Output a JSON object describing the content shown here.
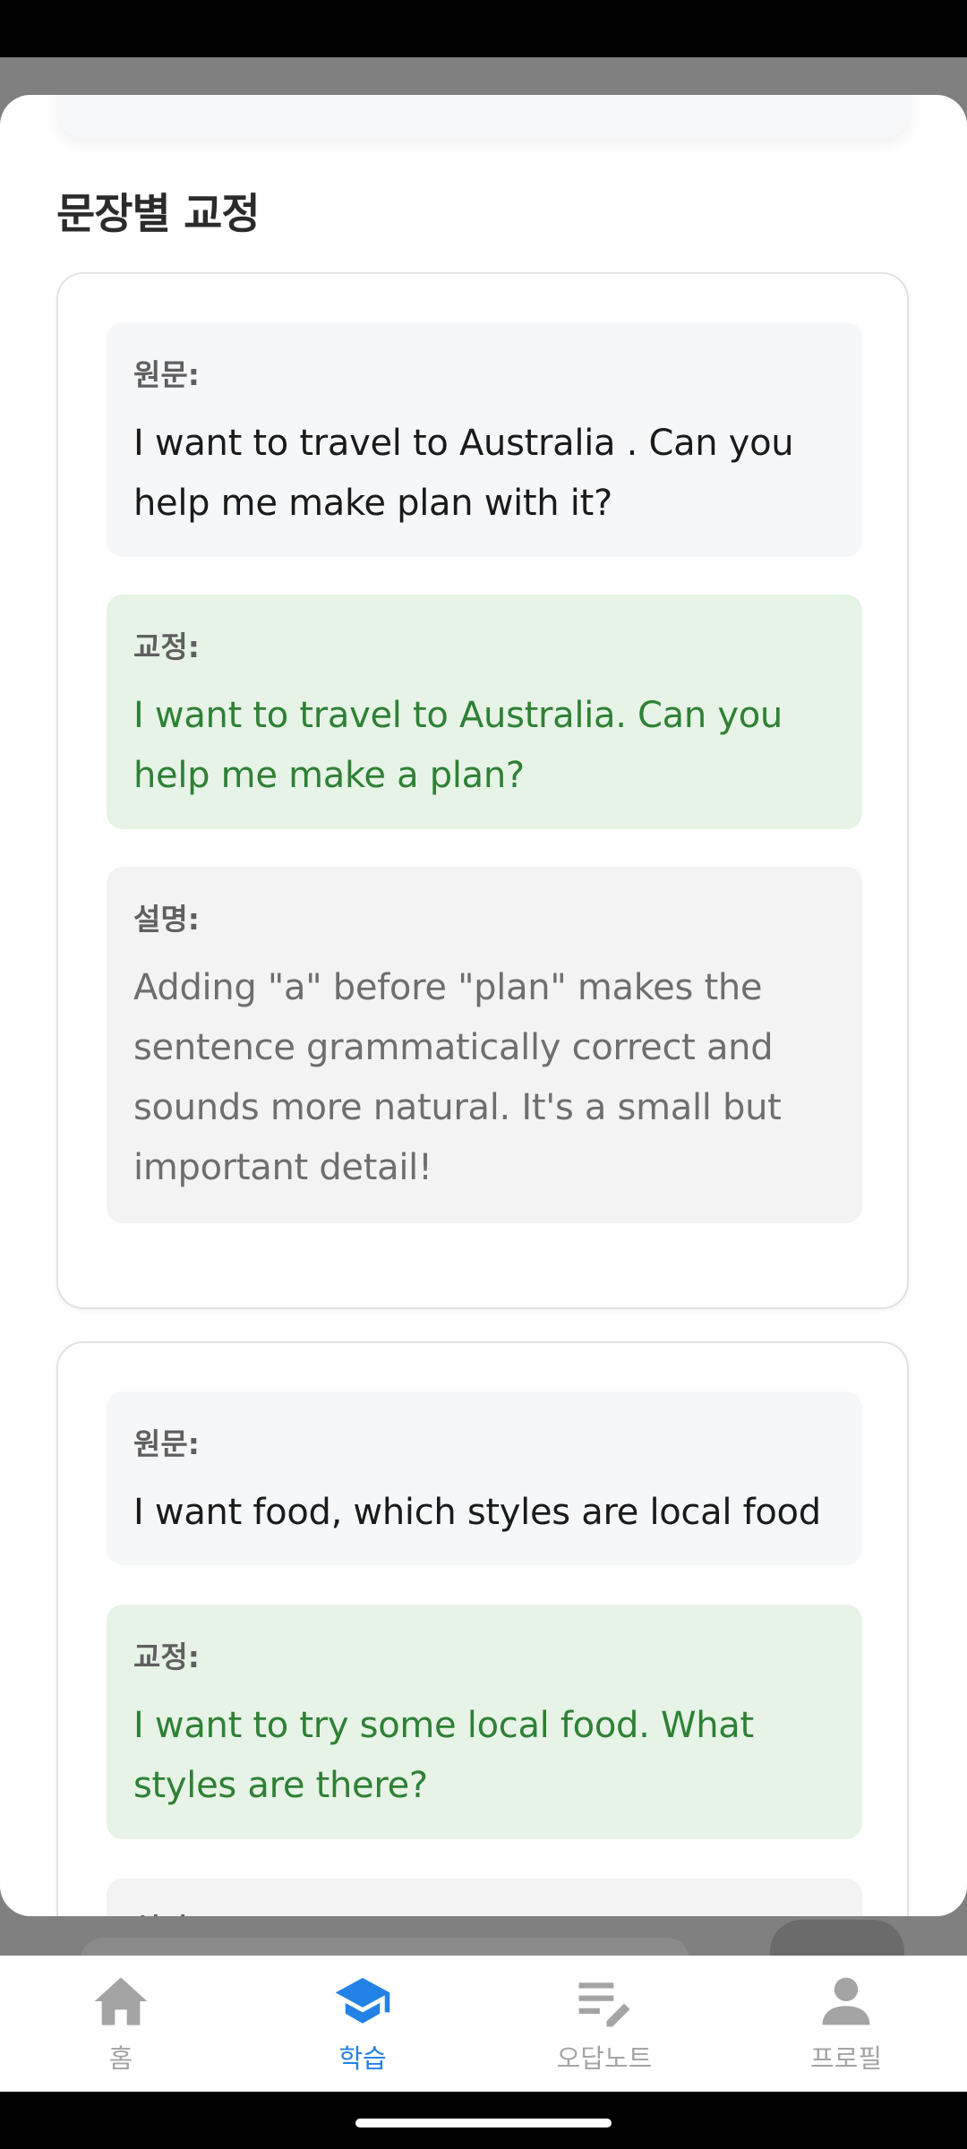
{
  "sheet": {
    "section_title": "문장별 교정",
    "corrections": [
      {
        "original_label": "원문:",
        "original_text": "I want to travel to Australia . Can you help me make plan with it?",
        "corrected_label": "교정:",
        "corrected_text": "I want to travel to Australia. Can you help me make a plan?",
        "explanation_label": "설명:",
        "explanation_text": "Adding \"a\" before \"plan\" makes the sentence grammatically correct and sounds more natural. It's a small but important detail!"
      },
      {
        "original_label": "원문:",
        "original_text": "I want food, which styles are local food",
        "corrected_label": "교정:",
        "corrected_text": "I want to try some local food. What styles are there?",
        "explanation_label": "설명:"
      }
    ]
  },
  "nav": {
    "items": [
      {
        "label": "홈",
        "icon": "home-icon"
      },
      {
        "label": "학습",
        "icon": "graduation-cap-icon"
      },
      {
        "label": "오답노트",
        "icon": "edit-note-icon"
      },
      {
        "label": "프로필",
        "icon": "person-icon"
      }
    ],
    "active_index": 1
  },
  "colors": {
    "accent": "#2382e5",
    "corrected_text": "#2e8035",
    "corrected_bg": "#e6f3e6",
    "inactive_nav": "#a4a4a4"
  }
}
